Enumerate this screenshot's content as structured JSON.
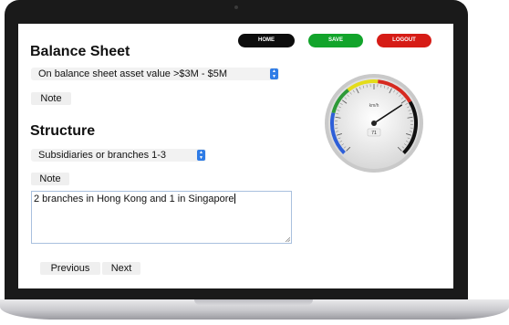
{
  "toolbar": {
    "home_label": "HOME",
    "save_label": "SAVE",
    "logout_label": "LOGOUT"
  },
  "balance_sheet": {
    "title": "Balance Sheet",
    "selected": "On balance sheet asset value >$3M - $5M",
    "note_label": "Note"
  },
  "structure": {
    "title": "Structure",
    "selected": "Subsidiaries or branches 1-3",
    "note_label": "Note",
    "note_text": "2 branches in Hong Kong and 1 in Singapore"
  },
  "nav": {
    "previous_label": "Previous",
    "next_label": "Next"
  },
  "gauge": {
    "value_label": "71",
    "unit_label": "km/h",
    "needle_value": 71,
    "scale_max": 100,
    "colors": {
      "green": "#2e9a38",
      "yellow": "#e4dc1a",
      "red": "#d62a20",
      "blue": "#2e5fd8",
      "dark": "#111111"
    }
  },
  "colors": {
    "home": "#0d0d0d",
    "save": "#12a42b",
    "logout": "#d61c16",
    "select_arrow": "#2f7ce6"
  }
}
